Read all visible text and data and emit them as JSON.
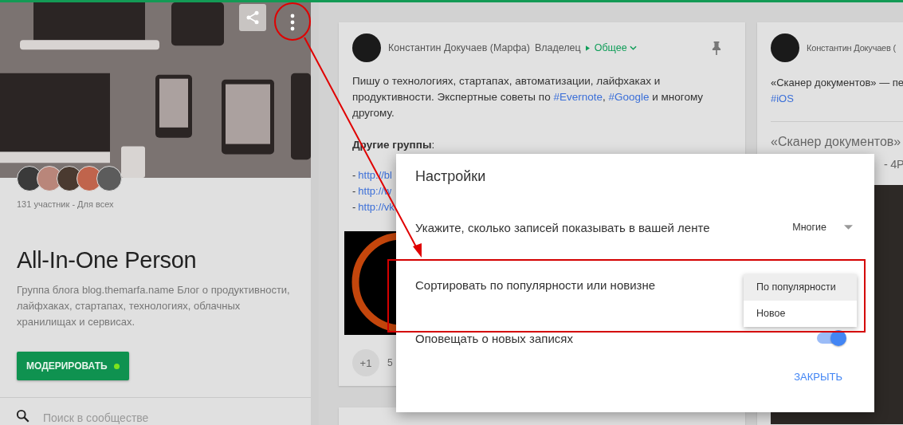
{
  "group": {
    "member_count": "131 участник - Для всех",
    "name": "All-In-One Person",
    "description": "Группа блога blog.themarfa.name Блог о продуктивности, лайфхаках, стартапах, технологиях, облачных хранилищах и сервисах.",
    "moderate_button": "МОДЕРИРОВАТЬ",
    "search": {
      "placeholder": "Поиск в сообществе"
    }
  },
  "posts": [
    {
      "author": "Константин Докучаев (Марфа)",
      "role": "Владелец",
      "audience": "Общее",
      "text": [
        {
          "kind": "text",
          "text": "Пишу о технологиях, стартапах, автоматизации, лайфхаках и продуктивности. Экспертные советы по "
        },
        {
          "kind": "link",
          "text": "#Evernote"
        },
        {
          "kind": "text",
          "text": ", "
        },
        {
          "kind": "link",
          "text": "#Google"
        },
        {
          "kind": "text",
          "text": " и многому другому."
        }
      ],
      "other_groups": "**Другие группы**:",
      "links": [
        {
          "marker": "-",
          "url": "http://bl"
        },
        {
          "marker": "-",
          "url": "http://w"
        },
        {
          "marker": "-",
          "url": "http://vk"
        }
      ],
      "plus_one": "+1",
      "plus_count": "5"
    },
    {
      "author": "Константин Докучаев (",
      "text": "«Сканер документов» — пе",
      "hashtag": "#iOS",
      "headline": "«Сканер документов»",
      "headline_end": "- 4P"
    }
  ],
  "settings_dialog": {
    "title": "Настройки",
    "rows": [
      {
        "kind": "select",
        "label": "Укажите, сколько записей показывать в вашей ленте",
        "value": "Многие"
      },
      {
        "kind": "menu",
        "label": "Сортировать по популярности или новизне",
        "options": [
          {
            "label": "По популярности",
            "selected": true
          },
          {
            "label": "Новое",
            "selected": false
          }
        ]
      },
      {
        "kind": "toggle",
        "label": "Оповещать о новых записях",
        "on": true
      }
    ],
    "close_button": "ЗАКРЫТЬ"
  }
}
